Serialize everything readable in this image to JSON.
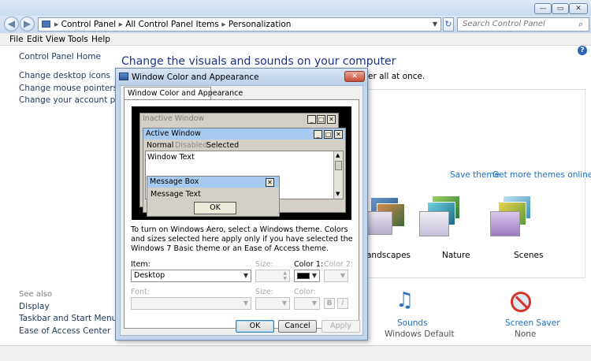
{
  "window": {
    "caption_buttons": [
      "—",
      "▭",
      "✕"
    ]
  },
  "address": {
    "path": [
      "Control Panel",
      "All Control Panel Items",
      "Personalization"
    ],
    "search_placeholder": "Search Control Panel"
  },
  "menu": [
    "File",
    "Edit",
    "View",
    "Tools",
    "Help"
  ],
  "left_nav": {
    "home": "Control Panel Home",
    "links": [
      "Change desktop icons",
      "Change mouse pointers",
      "Change your account picture"
    ],
    "see_also_header": "See also",
    "see_also": [
      "Display",
      "Taskbar and Start Menu",
      "Ease of Access Center"
    ]
  },
  "main": {
    "title": "Change the visuals and sounds on your computer",
    "subtitle_fragment": "er all at once.",
    "save_theme": "Save theme",
    "more_themes": "Get more themes online",
    "themes": [
      {
        "name": "andscapes"
      },
      {
        "name": "Nature"
      },
      {
        "name": "Scenes"
      }
    ],
    "bottom": [
      {
        "label": "Sounds",
        "value": "Windows Default"
      },
      {
        "label": "Screen Saver",
        "value": "None"
      }
    ]
  },
  "dialog": {
    "title": "Window Color and Appearance",
    "close": "✕",
    "tab": "Window Color and Appearance",
    "preview": {
      "inactive_title": "Inactive Window",
      "active_title": "Active Window",
      "menu_normal": "Normal",
      "menu_disabled": "Disabled",
      "menu_selected": "Selected",
      "window_text": "Window Text",
      "msgbox_title": "Message Box",
      "msgbox_text": "Message Text",
      "msgbox_ok": "OK"
    },
    "instructions": "To turn on Windows Aero, select a Windows theme.  Colors and sizes selected here apply only if you have selected the Windows 7 Basic theme or an Ease of Access theme.",
    "item_label": "Item:",
    "item_value": "Desktop",
    "size_label": "Size:",
    "color1_label": "Color 1:",
    "color2_label": "Color 2:",
    "color1_value": "#000000",
    "font_label": "Font:",
    "font_size_label": "Size:",
    "font_color_label": "Color:",
    "bold": "B",
    "italic": "I",
    "ok": "OK",
    "cancel": "Cancel",
    "apply": "Apply"
  },
  "colors": {
    "active_title": "#a6caf0",
    "inactive_title": "#d4d0c8",
    "title_text_blue": "#1e3287",
    "link_blue": "#1e6fbf"
  }
}
